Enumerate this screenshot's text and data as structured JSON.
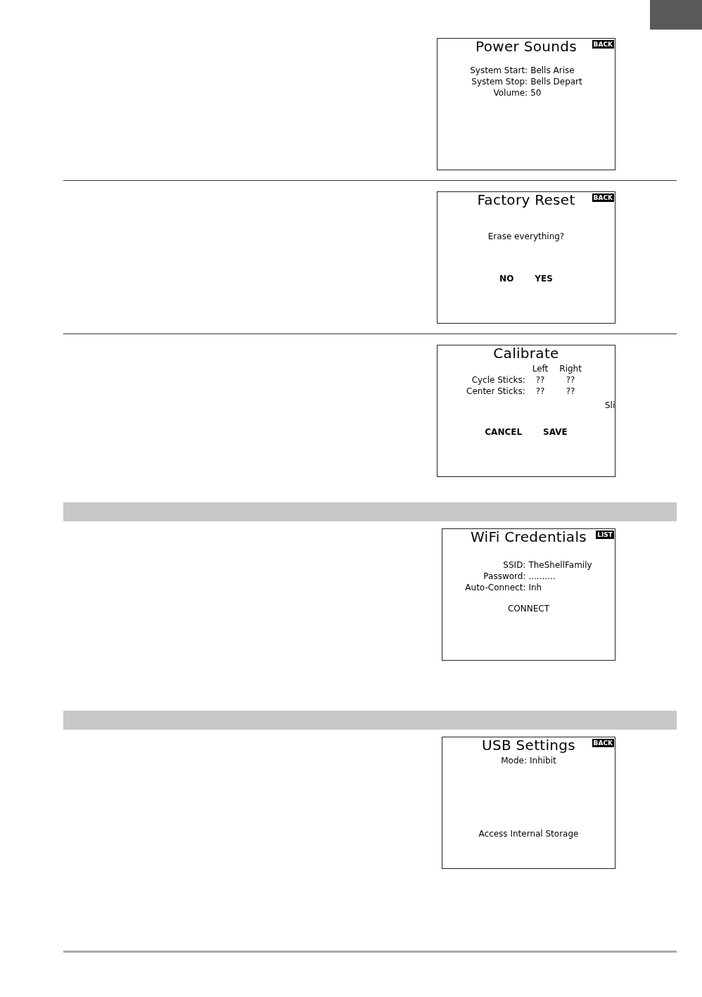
{
  "sections": [
    {
      "divider": {
        "kind": "rule"
      },
      "screen": {
        "title": "Power Sounds",
        "badge": "BACK",
        "fields": [
          {
            "label": "System Start:",
            "values": [
              "Bells Arise"
            ]
          },
          {
            "label": "System Stop:",
            "values": [
              "Bells Depart"
            ]
          },
          {
            "label": "Volume:",
            "values": [
              "50"
            ]
          }
        ]
      }
    },
    {
      "divider": {
        "kind": "rule"
      },
      "screen": {
        "title": "Factory Reset",
        "badge": "BACK",
        "prompt": "Erase everything?",
        "actions": [
          "NO",
          "YES"
        ]
      }
    },
    {
      "divider": {
        "kind": "band"
      },
      "screen": {
        "title": "Calibrate",
        "headers": [
          "Left",
          "Right"
        ],
        "fields": [
          {
            "label": "Cycle Sticks:",
            "values": [
              "??",
              "??"
            ]
          },
          {
            "label": "Center Sticks:",
            "values": [
              "??",
              "??"
            ]
          }
        ],
        "clipped": "Sli",
        "actions": [
          "CANCEL",
          "SAVE"
        ]
      }
    },
    {
      "divider": {
        "kind": "band"
      },
      "screen": {
        "title": "WiFi Credentials",
        "badge": "LIST",
        "fields": [
          {
            "label": "SSID:",
            "values": [
              "TheShellFamily"
            ]
          },
          {
            "label": "Password:",
            "values": [
              ".........."
            ]
          },
          {
            "label": "Auto-Connect:",
            "values": [
              "Inh"
            ]
          }
        ],
        "links": [
          "CONNECT"
        ]
      }
    },
    {
      "divider": {
        "kind": "end"
      },
      "screen": {
        "title": "USB Settings",
        "badge": "BACK",
        "fields": [
          {
            "label": "Mode:",
            "values": [
              "Inhibit"
            ]
          }
        ],
        "links": [
          "Access Internal Storage"
        ]
      }
    }
  ]
}
